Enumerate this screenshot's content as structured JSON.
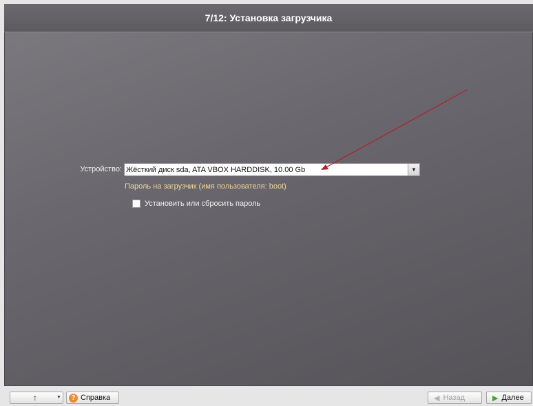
{
  "title": "7/12: Установка загрузчика",
  "device": {
    "label": "Устройство:",
    "value": "Жёсткий диск sda, ATA VBOX HARDDISK, 10.00 Gb"
  },
  "password_hint": "Пароль на загрузчик (имя пользователя: boot)",
  "password_checkbox": {
    "label": "Установить или сбросить пароль",
    "checked": false
  },
  "bottom_bar": {
    "up_icon": "up-arrow-icon",
    "help_label": "Справка",
    "help_icon": "question-icon",
    "back_label": "Назад",
    "next_label": "Далее"
  },
  "colors": {
    "hint": "#ecd69a",
    "help_icon": "#f08b2a",
    "next_chevron": "#49a52f",
    "annotation_arrow": "#b0202a"
  }
}
